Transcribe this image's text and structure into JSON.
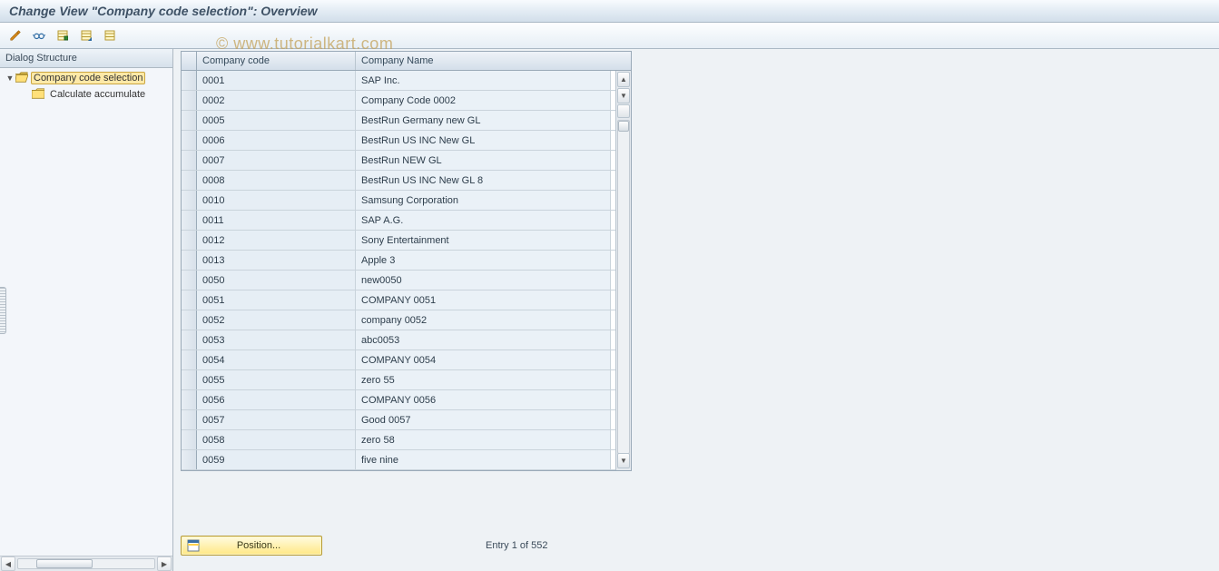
{
  "title": "Change View \"Company code selection\": Overview",
  "toolbar": {
    "icons": [
      "pencil-icon",
      "glasses-icon",
      "expand-icon",
      "select-all-icon",
      "deselect-all-icon"
    ]
  },
  "watermark": "© www.tutorialkart.com",
  "sidebar": {
    "header": "Dialog Structure",
    "items": [
      {
        "label": "Company code selection",
        "selected": true,
        "level": 0,
        "open_folder": true,
        "has_toggle": true
      },
      {
        "label": "Calculate accumulate",
        "selected": false,
        "level": 1,
        "open_folder": false,
        "has_toggle": false
      }
    ]
  },
  "grid": {
    "columns": [
      "Company code",
      "Company Name"
    ],
    "rows": [
      {
        "code": "0001",
        "name": "SAP Inc."
      },
      {
        "code": "0002",
        "name": "Company Code 0002"
      },
      {
        "code": "0005",
        "name": "BestRun Germany new GL"
      },
      {
        "code": "0006",
        "name": "BestRun US INC New GL"
      },
      {
        "code": "0007",
        "name": "BestRun NEW GL"
      },
      {
        "code": "0008",
        "name": "BestRun US INC New GL 8"
      },
      {
        "code": "0010",
        "name": "Samsung Corporation"
      },
      {
        "code": "0011",
        "name": "SAP A.G."
      },
      {
        "code": "0012",
        "name": "Sony Entertainment"
      },
      {
        "code": "0013",
        "name": "Apple 3"
      },
      {
        "code": "0050",
        "name": "new0050"
      },
      {
        "code": "0051",
        "name": "COMPANY 0051"
      },
      {
        "code": "0052",
        "name": "company 0052"
      },
      {
        "code": "0053",
        "name": "abc0053"
      },
      {
        "code": "0054",
        "name": "COMPANY 0054"
      },
      {
        "code": "0055",
        "name": "zero 55"
      },
      {
        "code": "0056",
        "name": "COMPANY 0056"
      },
      {
        "code": "0057",
        "name": "Good 0057"
      },
      {
        "code": "0058",
        "name": "zero 58"
      },
      {
        "code": "0059",
        "name": "five nine"
      }
    ]
  },
  "footer": {
    "position_label": "Position...",
    "entry_label": "Entry 1 of 552"
  }
}
